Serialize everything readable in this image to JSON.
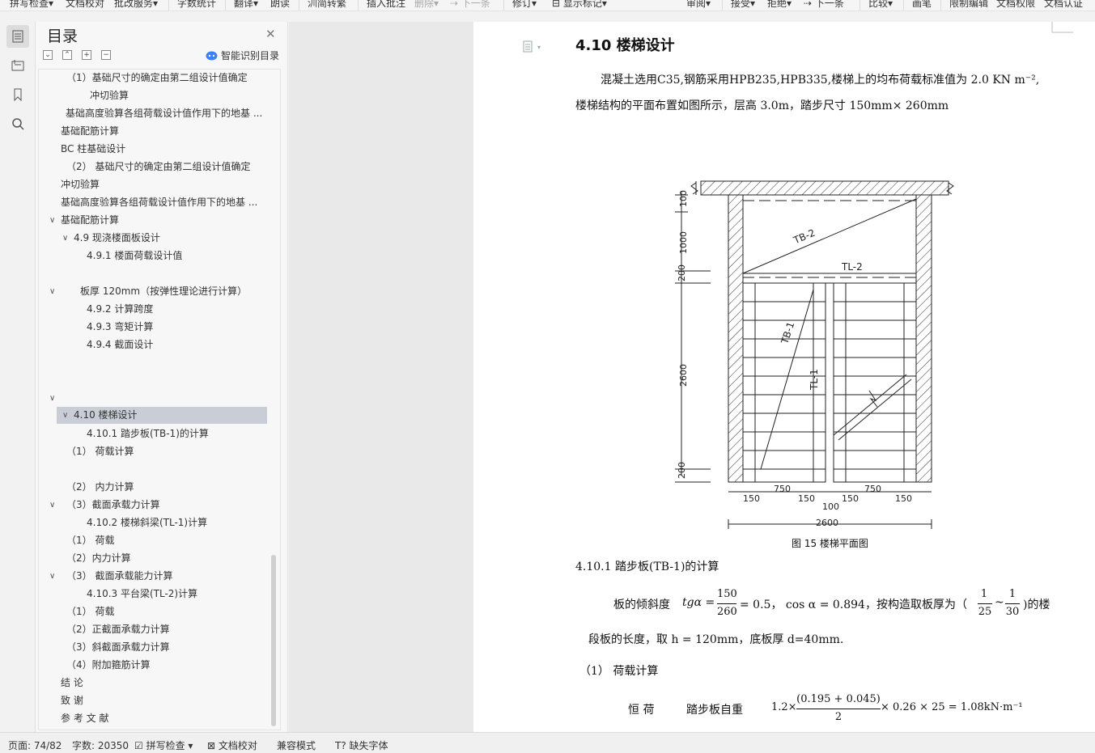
{
  "toolbar": {
    "items": [
      "拼写检查",
      "文档校对",
      "批改服务",
      "字数统计",
      "翻译",
      "朗读",
      "简转繁",
      "插入批注",
      "删除",
      "下一条",
      "修订",
      "显示标记",
      "审阅",
      "接受",
      "拒绝",
      "下一条",
      "比较",
      "画笔",
      "限制编辑",
      "文档权限",
      "文档认证"
    ]
  },
  "toc": {
    "title": "目录",
    "smart_label": "智能识别目录",
    "items": [
      {
        "text": "（1）基础尺寸的确定由第二组设计值确定"
      },
      {
        "text": "冲切验算"
      },
      {
        "text": "基础高度验算各组荷载设计值作用下的地基 ..."
      },
      {
        "text": "基础配筋计算"
      },
      {
        "text": "BC 柱基础设计"
      },
      {
        "text": "（2）  基础尺寸的确定由第二组设计值确定"
      },
      {
        "text": "冲切验算"
      },
      {
        "text": "基础高度验算各组荷载设计值作用下的地基 ..."
      },
      {
        "text": "基础配筋计算"
      },
      {
        "text": "4.9  现浇楼面板设计"
      },
      {
        "text": "4.9.1 楼面荷载设计值"
      },
      {
        "text": "板厚  120mm（按弹性理论进行计算）"
      },
      {
        "text": "4.9.2  计算跨度"
      },
      {
        "text": "4.9.3 弯矩计算"
      },
      {
        "text": "4.9.4  截面设计"
      },
      {
        "text": ""
      },
      {
        "text": "4.10    楼梯设计"
      },
      {
        "text": "4.10.1    踏步板(TB-1)的计算"
      },
      {
        "text": "（1）  荷载计算"
      },
      {
        "text": "（2）  内力计算"
      },
      {
        "text": "（3）截面承载力计算"
      },
      {
        "text": "4.10.2    楼梯斜梁(TL-1)计算"
      },
      {
        "text": "（1）  荷载"
      },
      {
        "text": "（2）内力计算"
      },
      {
        "text": "（3）    截面承载能力计算"
      },
      {
        "text": "4.10.3  平台梁(TL-2)计算"
      },
      {
        "text": "（1）    荷载"
      },
      {
        "text": "（2）正截面承载力计算"
      },
      {
        "text": "（3）斜截面承载力计算"
      },
      {
        "text": "（4）附加箍筋计算"
      },
      {
        "text": "结    论"
      },
      {
        "text": "致    谢"
      },
      {
        "text": "参 考 文 献"
      }
    ]
  },
  "document": {
    "heading": "4.10    楼梯设计",
    "para1_line1": "混凝土选用C35,钢筋采用HPB235,HPB335,楼梯上的均布荷载标准值为 2.0 KN m⁻²,",
    "para1_line2": "楼梯结构的平面布置如图所示，层高 3.0m，踏步尺寸 150mm× 260mm",
    "figure": {
      "caption": "图 15  楼梯平面图",
      "labels": {
        "tb2": "TB-2",
        "tl2": "TL-2",
        "tb1": "TB-1",
        "tl1": "TL-1",
        "d100": "100",
        "d1000": "1000",
        "d200a": "200",
        "d2600v": "2600",
        "d200b": "200",
        "w750a": "750",
        "w750b": "750",
        "w150a": "150",
        "w150b": "150",
        "w150c": "150",
        "w150d": "150",
        "w100": "100",
        "w2600": "2600"
      }
    },
    "sub_heading": "4.10.1    踏步板(TB-1)的计算",
    "para2_a": "板的倾斜度",
    "para2_b": "tgα =",
    "frac1_num": "150",
    "frac1_den": "260",
    "para2_c": "= 0.5，  cos α = 0.894，按构造取板厚为（",
    "frac2_num": "1",
    "frac2_den": "25",
    "tilde": "~",
    "frac3_num": "1",
    "frac3_den": "30",
    "para2_d": ")的楼",
    "para3": "段板的长度，取 h = 120mm，底板厚 d=40mm.",
    "load_heading": "（1）  荷载计算",
    "dead_a": "恒    荷",
    "dead_b": "踏步板自重",
    "dead_c": "1.2×",
    "frac4_num": "(0.195 + 0.045)",
    "frac4_den": "2",
    "dead_d": "× 0.26 × 25 = 1.08kN·m⁻¹"
  },
  "status": {
    "page": "页面: 74/82",
    "words": "字数: 20350",
    "spell": "拼写检查",
    "proof": "文档校对",
    "compat": "兼容模式",
    "font": "缺失字体"
  }
}
